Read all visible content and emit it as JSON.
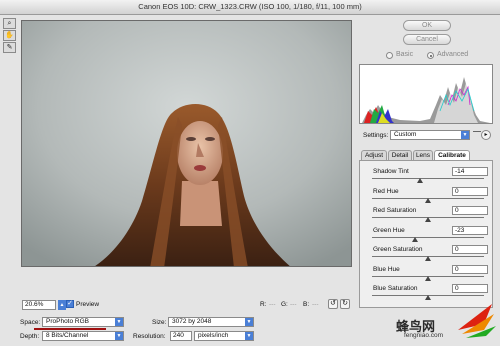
{
  "window": {
    "title": "Canon EOS 10D:  CRW_1323.CRW  (ISO 100, 1/180, f/11, 100 mm)"
  },
  "tools": [
    {
      "name": "zoom-tool-icon",
      "glyph": "⌕"
    },
    {
      "name": "hand-tool-icon",
      "glyph": "✋"
    },
    {
      "name": "eyedropper-tool-icon",
      "glyph": "✎"
    }
  ],
  "buttons": {
    "ok": "OK",
    "cancel": "Cancel"
  },
  "mode": {
    "basic": "Basic",
    "advanced": "Advanced",
    "selected": "advanced"
  },
  "settings": {
    "label": "Settings:",
    "value": "Custom"
  },
  "tabs": [
    {
      "label": "Adjust",
      "active": false
    },
    {
      "label": "Detail",
      "active": false
    },
    {
      "label": "Lens",
      "active": false
    },
    {
      "label": "Calibrate",
      "active": true
    }
  ],
  "sliders": [
    {
      "label": "Shadow Tint",
      "value": "-14",
      "pos": 0.43
    },
    {
      "label": "Red Hue",
      "value": "0",
      "pos": 0.5
    },
    {
      "label": "Red Saturation",
      "value": "0",
      "pos": 0.5
    },
    {
      "label": "Green Hue",
      "value": "-23",
      "pos": 0.38
    },
    {
      "label": "Green Saturation",
      "value": "0",
      "pos": 0.5
    },
    {
      "label": "Blue Hue",
      "value": "0",
      "pos": 0.5
    },
    {
      "label": "Blue Saturation",
      "value": "0",
      "pos": 0.5
    }
  ],
  "zoom": {
    "value": "20.6%"
  },
  "preview": {
    "label": "Preview",
    "checked": true
  },
  "readout": {
    "r": "R:",
    "g": "G:",
    "b": "B:",
    "dashes": "---"
  },
  "space": {
    "label": "Space:",
    "value": "ProPhoto RGB"
  },
  "size": {
    "label": "Size:",
    "value": "3072 by 2048"
  },
  "depth": {
    "label": "Depth:",
    "value": "8 Bits/Channel"
  },
  "resolution": {
    "label": "Resolution:",
    "value": "240",
    "unit": "pixels/inch"
  },
  "watermark": {
    "cn": "蜂鸟网",
    "url": "fengniao.com"
  },
  "colors": {
    "accent": "#4a7fd6",
    "underline": "#a01010",
    "preview_bg": "#b4bab8"
  }
}
